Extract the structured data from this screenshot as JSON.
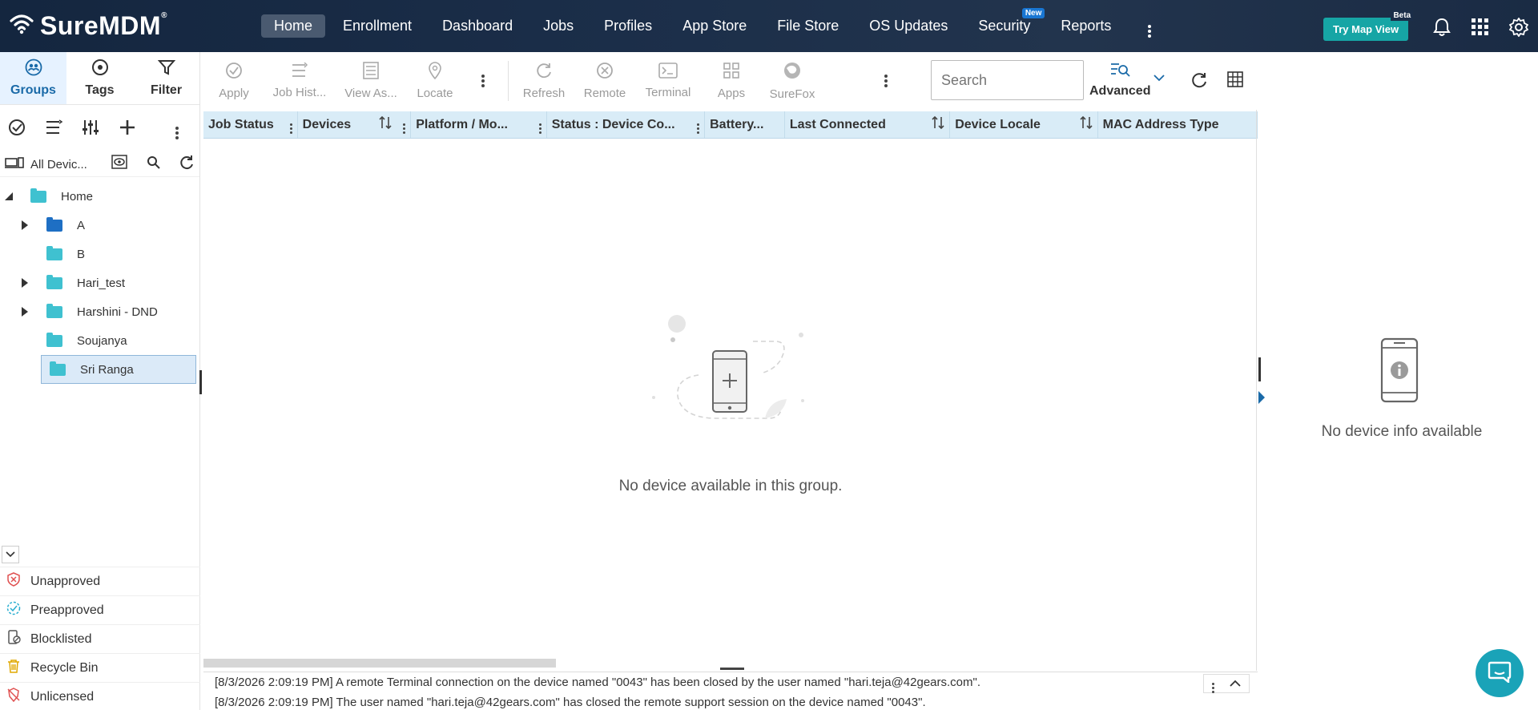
{
  "app": {
    "brand": "SureMDM",
    "reg": "®"
  },
  "nav": {
    "items": [
      {
        "label": "Home",
        "active": true
      },
      {
        "label": "Enrollment"
      },
      {
        "label": "Dashboard"
      },
      {
        "label": "Jobs"
      },
      {
        "label": "Profiles"
      },
      {
        "label": "App Store"
      },
      {
        "label": "File Store"
      },
      {
        "label": "OS Updates"
      },
      {
        "label": "Security",
        "badge": "New"
      },
      {
        "label": "Reports"
      }
    ],
    "try_map": "Try Map View",
    "beta": "Beta"
  },
  "left": {
    "tabs": [
      {
        "label": "Groups",
        "icon": "groups-icon",
        "active": true
      },
      {
        "label": "Tags",
        "icon": "tag-icon"
      },
      {
        "label": "Filter",
        "icon": "filter-icon"
      }
    ],
    "all_devices": "All Devic...",
    "tree": [
      {
        "label": "Home",
        "level": 0,
        "expanded": true,
        "color": "#3fc1d0"
      },
      {
        "label": "A",
        "level": 1,
        "caret": true,
        "color": "#1e6fc4"
      },
      {
        "label": "B",
        "level": 1,
        "caret": false,
        "color": "#3fc1d0"
      },
      {
        "label": "Hari_test",
        "level": 1,
        "caret": true,
        "color": "#3fc1d0"
      },
      {
        "label": "Harshini - DND",
        "level": 1,
        "caret": true,
        "color": "#3fc1d0"
      },
      {
        "label": "Soujanya",
        "level": 1,
        "caret": false,
        "color": "#3fc1d0"
      },
      {
        "label": "Sri Ranga",
        "level": 1,
        "caret": false,
        "color": "#3fc1d0",
        "selected": true
      }
    ],
    "bottom": [
      {
        "label": "Unapproved",
        "icon": "unapproved-icon",
        "color": "#e05252"
      },
      {
        "label": "Preapproved",
        "icon": "preapproved-icon",
        "color": "#2aaed0"
      },
      {
        "label": "Blocklisted",
        "icon": "blocklist-icon",
        "color": "#555555"
      },
      {
        "label": "Recycle Bin",
        "icon": "recycle-bin-icon",
        "color": "#e0a800"
      },
      {
        "label": "Unlicensed",
        "icon": "unlicensed-icon",
        "color": "#e05252"
      }
    ]
  },
  "toolbar": {
    "apply": "Apply",
    "job_history": "Job Hist...",
    "view_as": "View As...",
    "locate": "Locate",
    "refresh": "Refresh",
    "remote": "Remote",
    "terminal": "Terminal",
    "apps": "Apps",
    "surefox": "SureFox",
    "search_placeholder": "Search",
    "advanced": "Advanced"
  },
  "grid": {
    "columns": [
      {
        "label": "Job Status",
        "sort": false,
        "width": 118
      },
      {
        "label": "Devices",
        "sort": true,
        "width": 142
      },
      {
        "label": "Platform / Mo...",
        "sort": false,
        "width": 170
      },
      {
        "label": "Status : Device Co...",
        "sort": false,
        "width": 198
      },
      {
        "label": "Battery...",
        "sort": false,
        "width": 100
      },
      {
        "label": "Last Connected",
        "sort": true,
        "width": 207
      },
      {
        "label": "Device Locale",
        "sort": true,
        "width": 185
      },
      {
        "label": "MAC Address Type",
        "sort": false,
        "width": 200
      }
    ],
    "empty_message": "No device available in this group."
  },
  "right": {
    "empty_message": "No device info available"
  },
  "log": {
    "lines": [
      "[8/3/2026 2:09:19 PM] A remote Terminal connection on the device named \"0043\" has been closed by the user named \"hari.teja@42gears.com\".",
      "[8/3/2026 2:09:19 PM] The user named \"hari.teja@42gears.com\" has closed the remote support session on the device named \"0043\"."
    ]
  },
  "colors": {
    "topbar": "#1b2e49",
    "accent": "#1a6aa8",
    "teal": "#16a5a5",
    "grid_header": "#d9ecf7"
  }
}
